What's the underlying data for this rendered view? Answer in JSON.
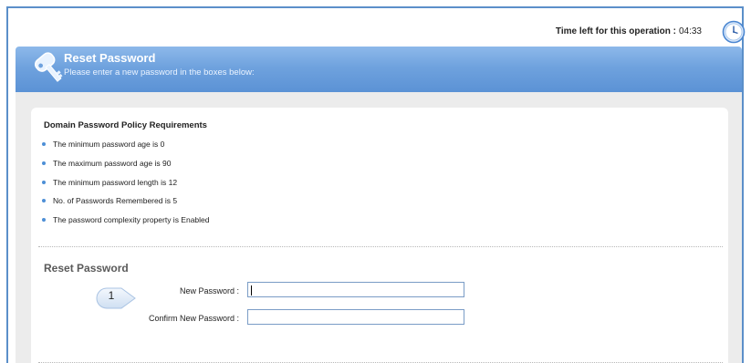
{
  "timer": {
    "label": "Time left for this operation :",
    "value": "04:33",
    "icon": "clock-icon"
  },
  "header": {
    "title": "Reset Password",
    "subtitle": "Please enter a new password in the boxes below:",
    "icon": "key-icon"
  },
  "policy": {
    "title": "Domain Password Policy Requirements",
    "items": [
      "The minimum password age is 0",
      "The maximum password age is 90",
      "The minimum password length is 12",
      "No. of Passwords Remembered is 5",
      "The password complexity property is Enabled"
    ]
  },
  "reset": {
    "heading": "Reset Password",
    "step": "1",
    "new_password_label": "New Password :",
    "new_password_value": "",
    "confirm_password_label": "Confirm New Password :",
    "confirm_password_value": ""
  },
  "colors": {
    "header_blue": "#6fa2de",
    "frame_blue": "#5b8fc9",
    "bullet_blue": "#4d8fd6"
  }
}
